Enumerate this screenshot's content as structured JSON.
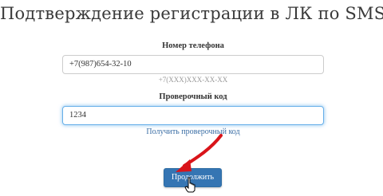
{
  "page": {
    "title": "Подтверждение регистрации в ЛК по SMS"
  },
  "phone": {
    "label": "Номер телефона",
    "value": "+7(987)654-32-10",
    "hint": "+7(XXX)XXX-XX-XX"
  },
  "code": {
    "label": "Проверочный код",
    "value": "1234",
    "link": "Получить проверочный код"
  },
  "submit": {
    "label": "Продолжить"
  },
  "colors": {
    "button": "#3575b3",
    "arrow": "#d9141a",
    "focus": "#66afe9"
  },
  "icons": [
    "red-arrow-icon",
    "cursor-hand-icon"
  ]
}
